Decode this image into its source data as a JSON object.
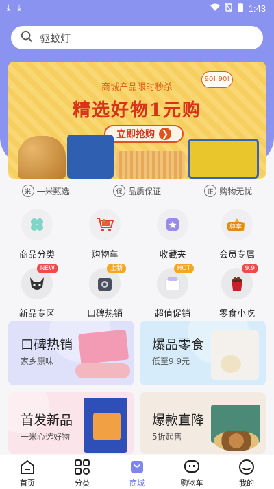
{
  "status_bar": {
    "time": "1:43"
  },
  "search": {
    "placeholder": "驱蚊灯"
  },
  "banner": {
    "subtitle": "商城产品限时秒杀",
    "title": "精选好物1元购",
    "button_label": "立即抢购",
    "bubble_text": "90! 90!"
  },
  "features": [
    {
      "icon": "rice-icon",
      "label": "一米甄选"
    },
    {
      "icon": "shield-icon",
      "label": "品质保证"
    },
    {
      "icon": "checkmark-circle-icon",
      "label": "购物无忧"
    }
  ],
  "grid": {
    "row1": [
      {
        "label": "商品分类",
        "icon": "category-icon"
      },
      {
        "label": "购物车",
        "icon": "cart-icon"
      },
      {
        "label": "收藏夹",
        "icon": "favorites-icon"
      },
      {
        "label": "会员专属",
        "icon": "member-icon",
        "icon_text": "尊享"
      }
    ],
    "row2": [
      {
        "label": "新品专区",
        "icon": "new-product-icon",
        "badge": "NEW"
      },
      {
        "label": "口碑热销",
        "icon": "hot-sale-icon",
        "badge": "上新"
      },
      {
        "label": "超值促销",
        "icon": "promotion-icon",
        "badge": "HOT"
      },
      {
        "label": "零食小吃",
        "icon": "snack-icon",
        "badge": "9.9"
      }
    ]
  },
  "cards": [
    {
      "title": "口碑热销",
      "subtitle": "家乡原味",
      "bg": "#dfe1fb"
    },
    {
      "title": "爆品零食",
      "subtitle": "低至9.9元",
      "bg": "#d7ecfa"
    },
    {
      "title": "首发新品",
      "subtitle": "一米心选好物",
      "bg": "#fbe4ea"
    },
    {
      "title": "爆款直降",
      "subtitle": "5折起售",
      "bg": "#f3ebe2"
    }
  ],
  "tabbar": [
    {
      "label": "首页",
      "icon": "home-icon"
    },
    {
      "label": "分类",
      "icon": "grid-icon"
    },
    {
      "label": "商城",
      "icon": "shopping-bag-icon",
      "active": true
    },
    {
      "label": "购物车",
      "icon": "cart-icon"
    },
    {
      "label": "我的",
      "icon": "profile-icon"
    }
  ],
  "colors": {
    "header": "#8a93f0",
    "accent": "#6a74ea",
    "banner": "#f8d36a",
    "promo_red": "#d8321a"
  }
}
